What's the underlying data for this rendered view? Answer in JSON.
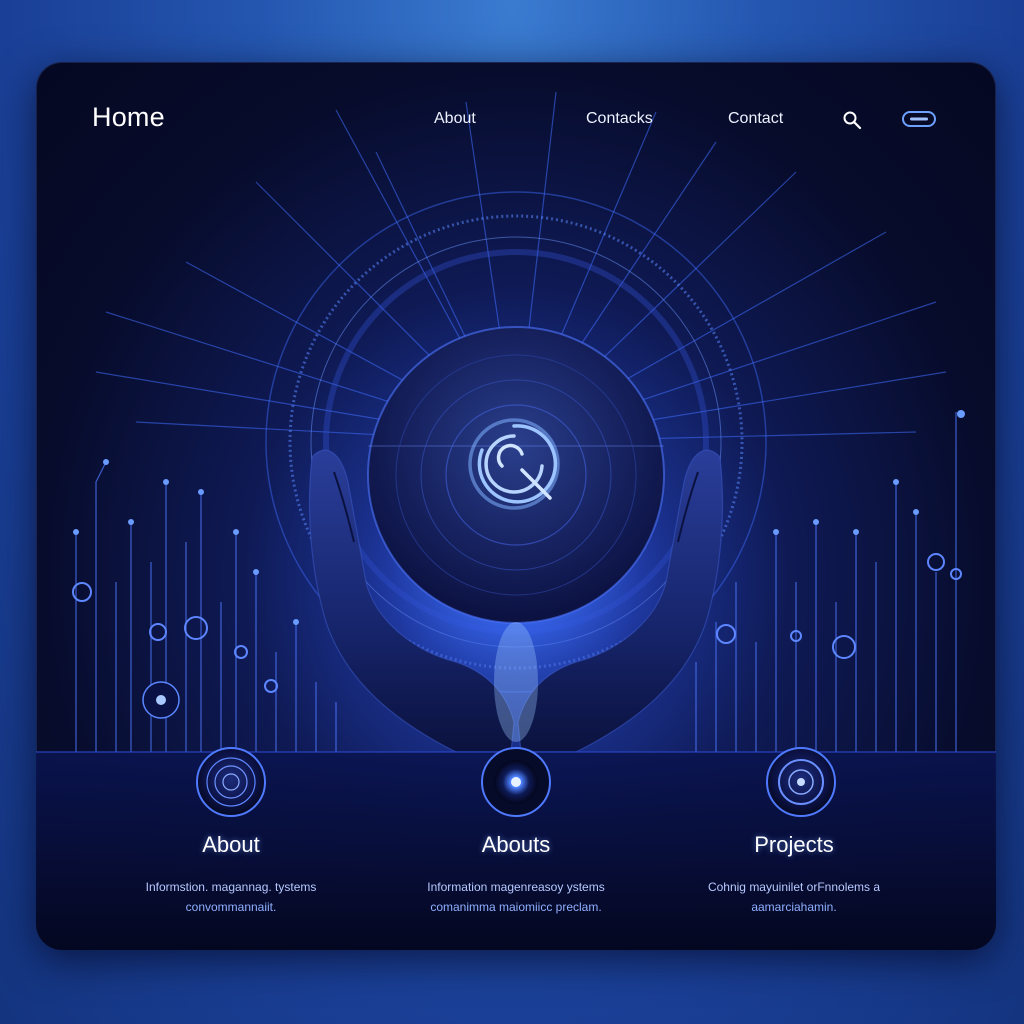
{
  "nav": {
    "home": "Home",
    "links": [
      "About",
      "Contacks",
      "Contact"
    ],
    "search_icon": "search-icon",
    "toggle_icon": "toggle-pill-icon"
  },
  "hero": {
    "orb_icon": "spiral-q-logo-icon",
    "hands": "cupped-hands-illustration"
  },
  "cards": [
    {
      "icon": "concentric-circle-icon",
      "title": "About",
      "desc_line1": "Informstion. magannag. tystems",
      "desc_line2": "convommannaiit."
    },
    {
      "icon": "glowing-lens-icon",
      "title": "Abouts",
      "desc_line1": "Information magenreasoy ystems",
      "desc_line2": "comanimma maiomiicc preclam."
    },
    {
      "icon": "target-ring-icon",
      "title": "Projects",
      "desc_line1": "Cohnig mayuinilet orFnnolems a",
      "desc_line2": "aamarciahamin."
    }
  ],
  "colors": {
    "accent": "#4a7dff",
    "glow": "#6fa4ff",
    "background": "#070c2c",
    "outer": "#2456b0"
  }
}
